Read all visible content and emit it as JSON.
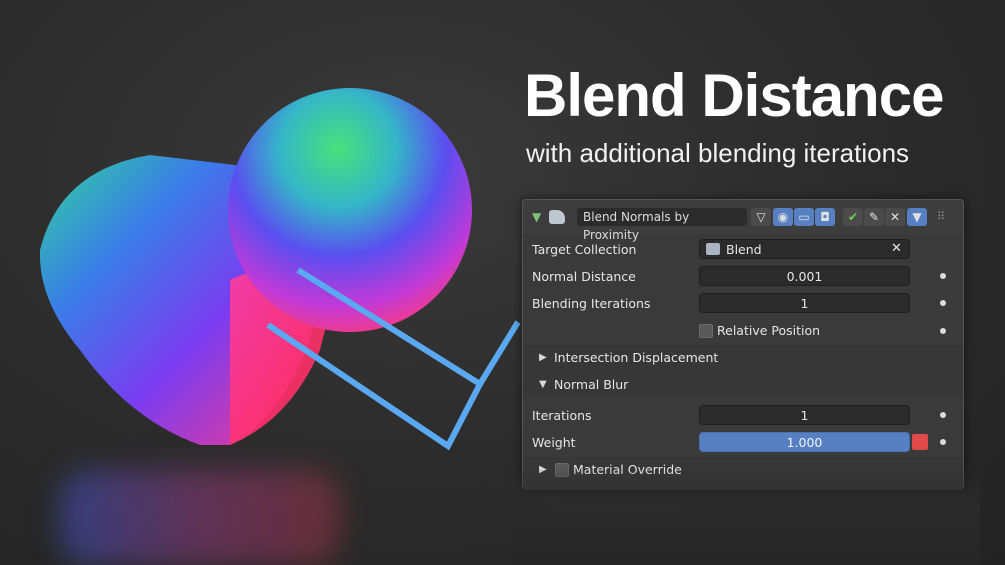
{
  "title": "Blend Distance",
  "subtitle": "with additional blending iterations",
  "colors": {
    "highlight": "#5aa9f0",
    "panel_bg": "#3a3a3a",
    "field_bg": "#2b2b2b",
    "active_blue": "#5680c2",
    "check_green": "#6ecf57"
  },
  "modifier": {
    "name": "Blend Normals by Proximity",
    "icons": [
      "collapse-triangle-icon",
      "modifier-icon",
      "mesh-icon",
      "edit-mode-icon",
      "viewport-icon",
      "render-icon",
      "apply-check-icon",
      "eyedropper-icon",
      "close-icon",
      "dropdown-icon",
      "drag-grip-icon"
    ]
  },
  "fields": {
    "target_collection": {
      "label": "Target Collection",
      "value": "Blend"
    },
    "normal_distance": {
      "label": "Normal Distance",
      "value": "0.001"
    },
    "blending_iterations": {
      "label": "Blending Iterations",
      "value": "1"
    },
    "relative_position": {
      "label": "Relative Position"
    }
  },
  "sections": {
    "intersection": "Intersection Displacement",
    "normal_blur": "Normal Blur",
    "material_override": "Material Override"
  },
  "normal_blur": {
    "iterations": {
      "label": "Iterations",
      "value": "1"
    },
    "weight": {
      "label": "Weight",
      "value": "1.000"
    }
  }
}
